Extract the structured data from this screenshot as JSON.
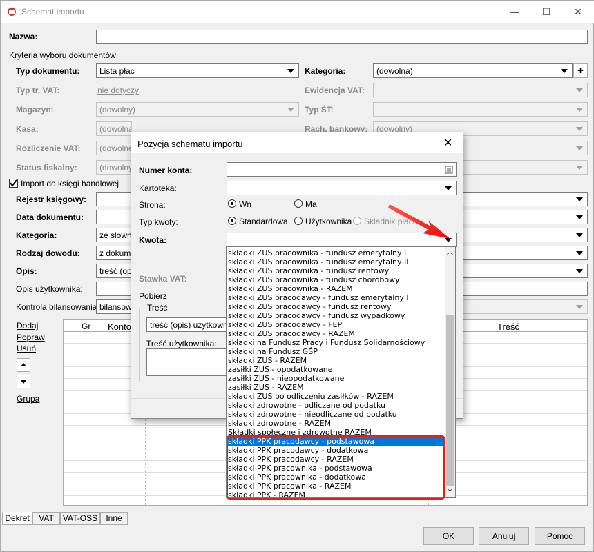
{
  "window": {
    "title": "Schemat importu",
    "minimize": "—",
    "maximize": "☐",
    "close": "✕"
  },
  "main": {
    "nazwa_label": "Nazwa:",
    "kryteria_label": "Kryteria wyboru dokumentów",
    "typ_dok_label": "Typ dokumentu:",
    "typ_dok_value": "Lista płac",
    "kategoria_label": "Kategoria:",
    "kategoria_value": "(dowolna)",
    "typ_vat_label": "Typ tr. VAT:",
    "typ_vat_value": "nie dotyczy",
    "ewidencja_label": "Ewidencja VAT:",
    "magazyn_label": "Magazyn:",
    "magazyn_value": "(dowolny)",
    "typ_st_label": "Typ ŚT:",
    "kasa_label": "Kasa:",
    "kasa_value": "(dowolna)",
    "rach_label": "Rach. bankowy:",
    "rach_value": "(dowolny)",
    "rozl_label": "Rozliczenie VAT:",
    "rozl_value": "(dowolne)",
    "status_label": "Status fiskalny:",
    "status_value": "(dowolny)",
    "import_label": "Import do księgi handlowej",
    "rejestr_label": "Rejestr księgowy:",
    "data_label": "Data dokumentu:",
    "kat2_label": "Kategoria:",
    "kat2_value": "ze słownika",
    "rodzaj_label": "Rodzaj dowodu:",
    "rodzaj_value": "z dokumentu",
    "opis_label": "Opis:",
    "opis_value": "treść (opis) użytkownika",
    "opis_uzyt_label": "Opis użytkownika:",
    "kontrola_label": "Kontrola bilansowania:",
    "kontrola_value": "bilansowanie",
    "links": {
      "dodaj": "Dodaj",
      "popraw": "Popraw",
      "usun": "Usuń",
      "grupa": "Grupa"
    },
    "grid_headers": {
      "gr": "Gr",
      "konto": "Konto",
      "tresc": "Treść"
    },
    "tabs": [
      "Dekret",
      "VAT",
      "VAT-OSS",
      "Inne"
    ],
    "buttons": {
      "ok": "OK",
      "anuluj": "Anuluj",
      "pomoc": "Pomoc"
    }
  },
  "dialog": {
    "title": "Pozycja schematu importu",
    "numer_label": "Numer konta:",
    "kartoteka_label": "Kartoteka:",
    "strona_label": "Strona:",
    "wn": "Wn",
    "ma": "Ma",
    "typ_kwoty_label": "Typ kwoty:",
    "standardowa": "Standardowa",
    "uzytkownika": "Użytkownika",
    "skladnik": "Składnik płacowy",
    "kwota_label": "Kwota:",
    "stawka_label": "Stawka VAT:",
    "pobierz_label": "Pobierz",
    "tresc_group": "Treść",
    "tresc_value": "treść (opis) użytkownika",
    "tresc_uzyt_label": "Treść użytkownika:"
  },
  "dropdown": {
    "items": [
      "składki ZUS pracownika - fundusz emerytalny I",
      "składki ZUS pracownika - fundusz emerytalny II",
      "składki ZUS pracownika - fundusz rentowy",
      "składki ZUS pracownika - fundusz chorobowy",
      "składki ZUS pracownika - RAZEM",
      "składki ZUS pracodawcy - fundusz emerytalny I",
      "składki ZUS pracodawcy - fundusz rentowy",
      "składki ZUS pracodawcy - fundusz wypadkowy",
      "składki ZUS pracodawcy - FEP",
      "składki ZUS pracodawcy - RAZEM",
      "składki na Fundusz Pracy i Fundusz Solidarnościowy",
      "składki na Fundusz GŚP",
      "składki ZUS - RAZEM",
      "zasiłki ZUS - opodatkowane",
      "zasiłki ZUS - nieopodatkowane",
      "zasiłki ZUS - RAZEM",
      "składki ZUS po odliczeniu zasiłków - RAZEM",
      "składki zdrowotne - odliczane od podatku",
      "składki zdrowotne - nieodliczane od podatku",
      "składki zdrowotne - RAZEM",
      "Składki społeczne i zdrowotne RAZEM",
      "składki PPK pracodawcy - podstawowa",
      "składki PPK pracodawcy - dodatkowa",
      "składki PPK pracodawcy - RAZEM",
      "składki PPK pracownika - podstawowa",
      "składki PPK pracownika - dodatkowa",
      "składki PPK pracownika - RAZEM",
      "składki PPK - RAZEM"
    ],
    "selected_index": 21,
    "highlight_color": "#e02020"
  }
}
